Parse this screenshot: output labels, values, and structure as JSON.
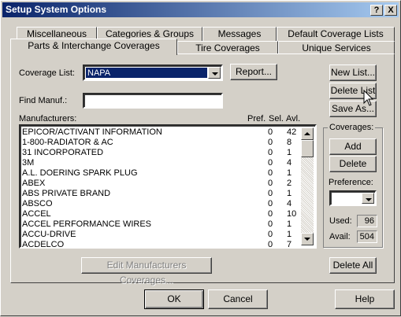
{
  "window": {
    "title": "Setup System Options",
    "help_glyph": "?",
    "close_glyph": "X"
  },
  "tabs": {
    "row1": [
      "Miscellaneous",
      "Categories & Groups",
      "Messages",
      "Default Coverage Lists"
    ],
    "row2": [
      "Parts & Interchange Coverages",
      "Tire Coverages",
      "Unique Services"
    ]
  },
  "coverage": {
    "label": "Coverage List:",
    "value": "NAPA",
    "report_label": "Report..."
  },
  "find": {
    "label": "Find Manuf.:",
    "value": ""
  },
  "list_header": {
    "manufacturers": "Manufacturers:",
    "pref": "Pref.",
    "sel": "Sel.",
    "avl": "Avl."
  },
  "manufacturers": [
    {
      "name": "EPICOR/ACTIVANT INFORMATION",
      "sel": "0",
      "avl": "42"
    },
    {
      "name": "1-800-RADIATOR & AC",
      "sel": "0",
      "avl": "8"
    },
    {
      "name": "31 INCORPORATED",
      "sel": "0",
      "avl": "1"
    },
    {
      "name": "3M",
      "sel": "0",
      "avl": "4"
    },
    {
      "name": "A.L. DOERING SPARK PLUG",
      "sel": "0",
      "avl": "1"
    },
    {
      "name": "ABEX",
      "sel": "0",
      "avl": "2"
    },
    {
      "name": "ABS PRIVATE BRAND",
      "sel": "0",
      "avl": "1"
    },
    {
      "name": "ABSCO",
      "sel": "0",
      "avl": "4"
    },
    {
      "name": "ACCEL",
      "sel": "0",
      "avl": "10"
    },
    {
      "name": "ACCEL PERFORMANCE WIRES",
      "sel": "0",
      "avl": "1"
    },
    {
      "name": "ACCU-DRIVE",
      "sel": "0",
      "avl": "1"
    },
    {
      "name": "ACDELCO",
      "sel": "0",
      "avl": "7"
    }
  ],
  "list_buttons": {
    "new_list": "New List...",
    "delete_list": "Delete List",
    "save_as": "Save As..."
  },
  "coverages_group": {
    "title": "Coverages:",
    "add": "Add",
    "delete": "Delete",
    "preference_label": "Preference:",
    "preference_value": "",
    "used_label": "Used:",
    "used_value": "96",
    "avail_label": "Avail:",
    "avail_value": "504"
  },
  "edit_button": "Edit Manufacturers Coverages...",
  "delete_all": "Delete All",
  "footer": {
    "ok": "OK",
    "cancel": "Cancel",
    "help": "Help"
  }
}
